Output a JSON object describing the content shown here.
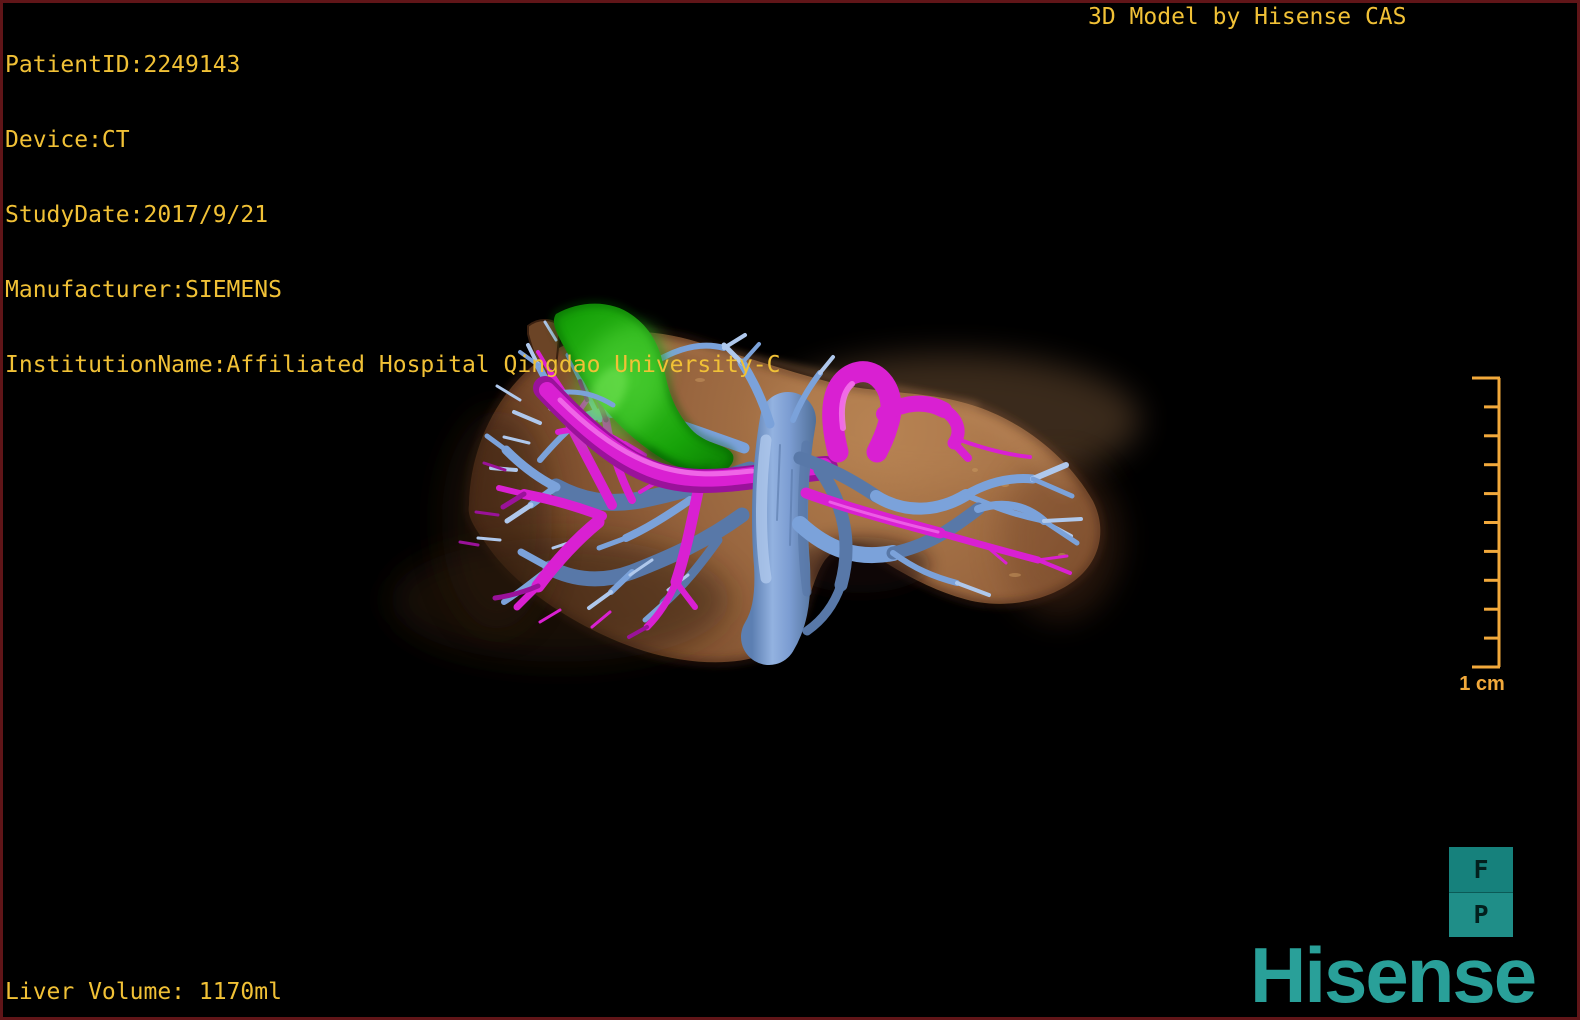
{
  "header": {
    "title": "3D Model by Hisense CAS"
  },
  "overlay": {
    "patient_id": "PatientID:2249143",
    "device": "Device:CT",
    "study_date": "StudyDate:2017/9/21",
    "manufacturer": "Manufacturer:SIEMENS",
    "institution": "InstitutionName:Affiliated Hospital Qingdao University-C"
  },
  "footer": {
    "liver_volume": "Liver Volume: 1170ml"
  },
  "scale_bar": {
    "label": "1 cm"
  },
  "orientation": {
    "front": "F",
    "posterior": "P"
  },
  "branding": {
    "logo": "Hisense"
  },
  "colors": {
    "overlay-yellow": "#F1C136",
    "ruler-gold": "#F2A93B",
    "brand-teal": "#29A099",
    "fp-top": "#16817C",
    "fp-bottom": "#1F8E88",
    "border-red": "#601518",
    "liver-tan": "#9A6842",
    "gallbladder-green": "#13A306",
    "portal-blue": "#7BA2DA",
    "vessel-magenta": "#D920D2",
    "background": "#000000"
  }
}
